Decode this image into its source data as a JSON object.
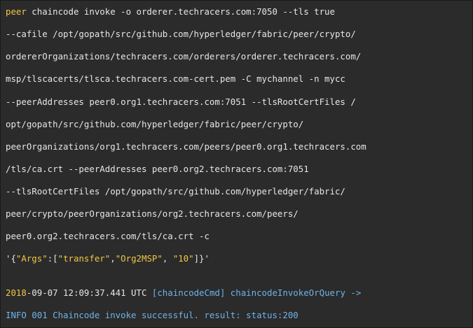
{
  "terminal": {
    "command": {
      "keyword": "peer",
      "line1_rest": " chaincode invoke -o orderer.techracers.com:7050 --tls true",
      "line2": "--cafile /opt/gopath/src/github.com/hyperledger/fabric/peer/crypto/",
      "line3": "ordererOrganizations/techracers.com/orderers/orderer.techracers.com/",
      "line4": "msp/tlscacerts/tlsca.techracers.com-cert.pem -C mychannel -n mycc",
      "line5": "--peerAddresses peer0.org1.techracers.com:7051 --tlsRootCertFiles /",
      "line6": "opt/gopath/src/github.com/hyperledger/fabric/peer/crypto/",
      "line7": "peerOrganizations/org1.techracers.com/peers/peer0.org1.techracers.com",
      "line8": "/tls/ca.crt --peerAddresses peer0.org2.techracers.com:7051",
      "line9": "--tlsRootCertFiles /opt/gopath/src/github.com/hyperledger/fabric/",
      "line10": "peer/crypto/peerOrganizations/org2.techracers.com/peers/",
      "line11": "peer0.org2.techracers.com/tls/ca.crt -c",
      "args": {
        "open_quote": "'{",
        "args_key": "\"Args\"",
        "colon_bracket": ":[",
        "arg1": "\"transfer\"",
        "comma1": ",",
        "arg2": "\"Org2MSP\"",
        "comma2": ", ",
        "arg3": "\"10\"",
        "close": "]}'"
      }
    },
    "output": {
      "year": "2018",
      "timestamp_rest": "-09-07 12:09:37.441 UTC ",
      "module": "[chaincodeCmd] chaincodeInvokeOrQuery ->",
      "result_line": "INFO 001 Chaincode invoke successful. result: status:200"
    }
  }
}
